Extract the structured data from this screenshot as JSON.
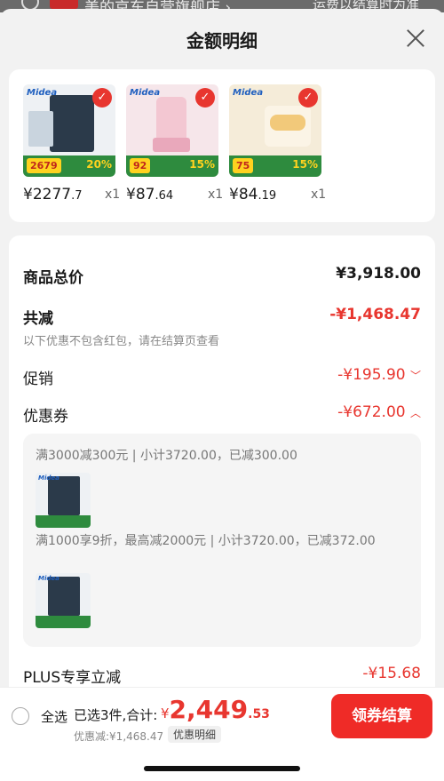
{
  "backdrop": {
    "store_text": "美的京东自营旗舰店 ›",
    "right_text": "运费以结算时为准"
  },
  "sheet": {
    "title": "金额明细"
  },
  "products": [
    {
      "brand": "Midea",
      "tag_price": "2679",
      "pct": "20%",
      "price_int": "¥2277",
      "price_dec": ".7",
      "qty": "x1"
    },
    {
      "brand": "Midea",
      "tag_price": "92",
      "pct": "15%",
      "price_int": "¥87",
      "price_dec": ".64",
      "qty": "x1"
    },
    {
      "brand": "Midea",
      "tag_price": "75",
      "pct": "15%",
      "price_int": "¥84",
      "price_dec": ".19",
      "qty": "x1"
    }
  ],
  "summary": {
    "total_label": "商品总价",
    "total_value": "¥3,918.00",
    "reduce_label": "共减",
    "reduce_value": "-¥1,468.47",
    "reduce_note": "以下优惠不包含红包，请在结算页查看",
    "promo_label": "促销",
    "promo_value": "-¥195.90",
    "coupon_label": "优惠券",
    "coupon_value": "-¥672.00",
    "plus_label": "PLUS专享立减",
    "plus_value": "-¥15.68"
  },
  "coupons": [
    {
      "text": "满3000减300元 | 小计3720.00，已减300.00",
      "brand": "Midea"
    },
    {
      "text": "满1000享9折，最高减2000元 | 小计3720.00，已减372.00",
      "brand": "Midea"
    }
  ],
  "bottom": {
    "select_all": "全选",
    "selected": "已选3件,合计:",
    "currency": "¥",
    "total_int": "2,449",
    "total_dec": ".53",
    "discount": "优惠减:¥1,468.47",
    "detail_chip": "优惠明细",
    "checkout": "领券结算"
  },
  "colors": {
    "accent_red": "#e8362f",
    "button_red": "#ef2b27",
    "promo_green": "#2e8b3e"
  }
}
